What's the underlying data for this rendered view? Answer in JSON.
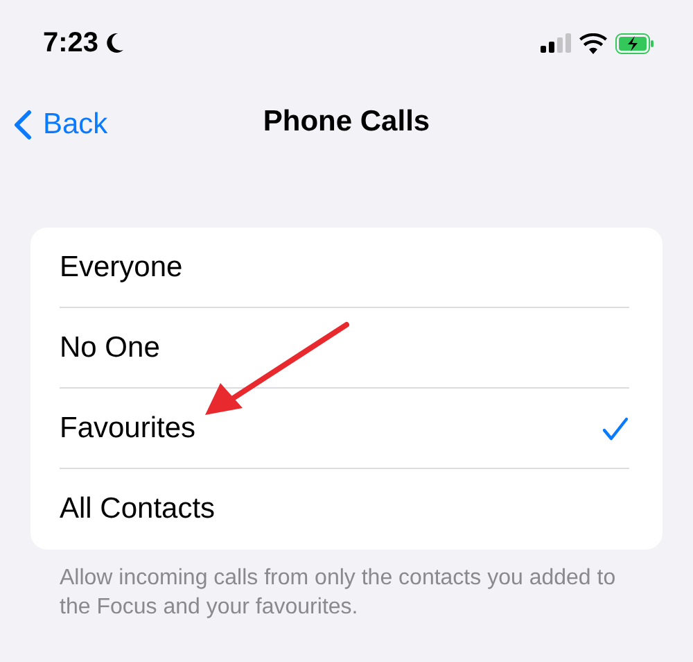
{
  "status_bar": {
    "time": "7:23"
  },
  "nav": {
    "back": "Back",
    "title": "Phone Calls"
  },
  "options": [
    {
      "label": "Everyone",
      "selected": false
    },
    {
      "label": "No One",
      "selected": false
    },
    {
      "label": "Favourites",
      "selected": true
    },
    {
      "label": "All Contacts",
      "selected": false
    }
  ],
  "footer": "Allow incoming calls from only the contacts you added to the Focus and your favourites."
}
